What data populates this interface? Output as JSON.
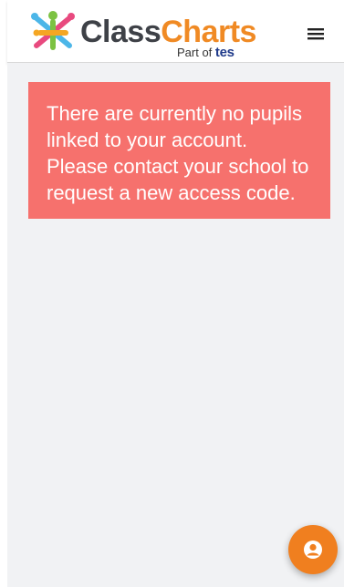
{
  "app": {
    "logo_part1": "Class",
    "logo_part2": "Charts",
    "logo_sub_prefix": "Part of",
    "logo_sub_brand": "tes"
  },
  "colors": {
    "brand_orange": "#f07f1f",
    "brand_dark": "#3e4147",
    "alert_bg": "#f6716d",
    "content_bg": "#f1f2f4"
  },
  "icons": {
    "menu": "hamburger-menu-icon",
    "account": "account-circle-icon"
  },
  "alert": {
    "message": "There are currently no pupils linked to your account. Please contact your school to request a new access code."
  }
}
